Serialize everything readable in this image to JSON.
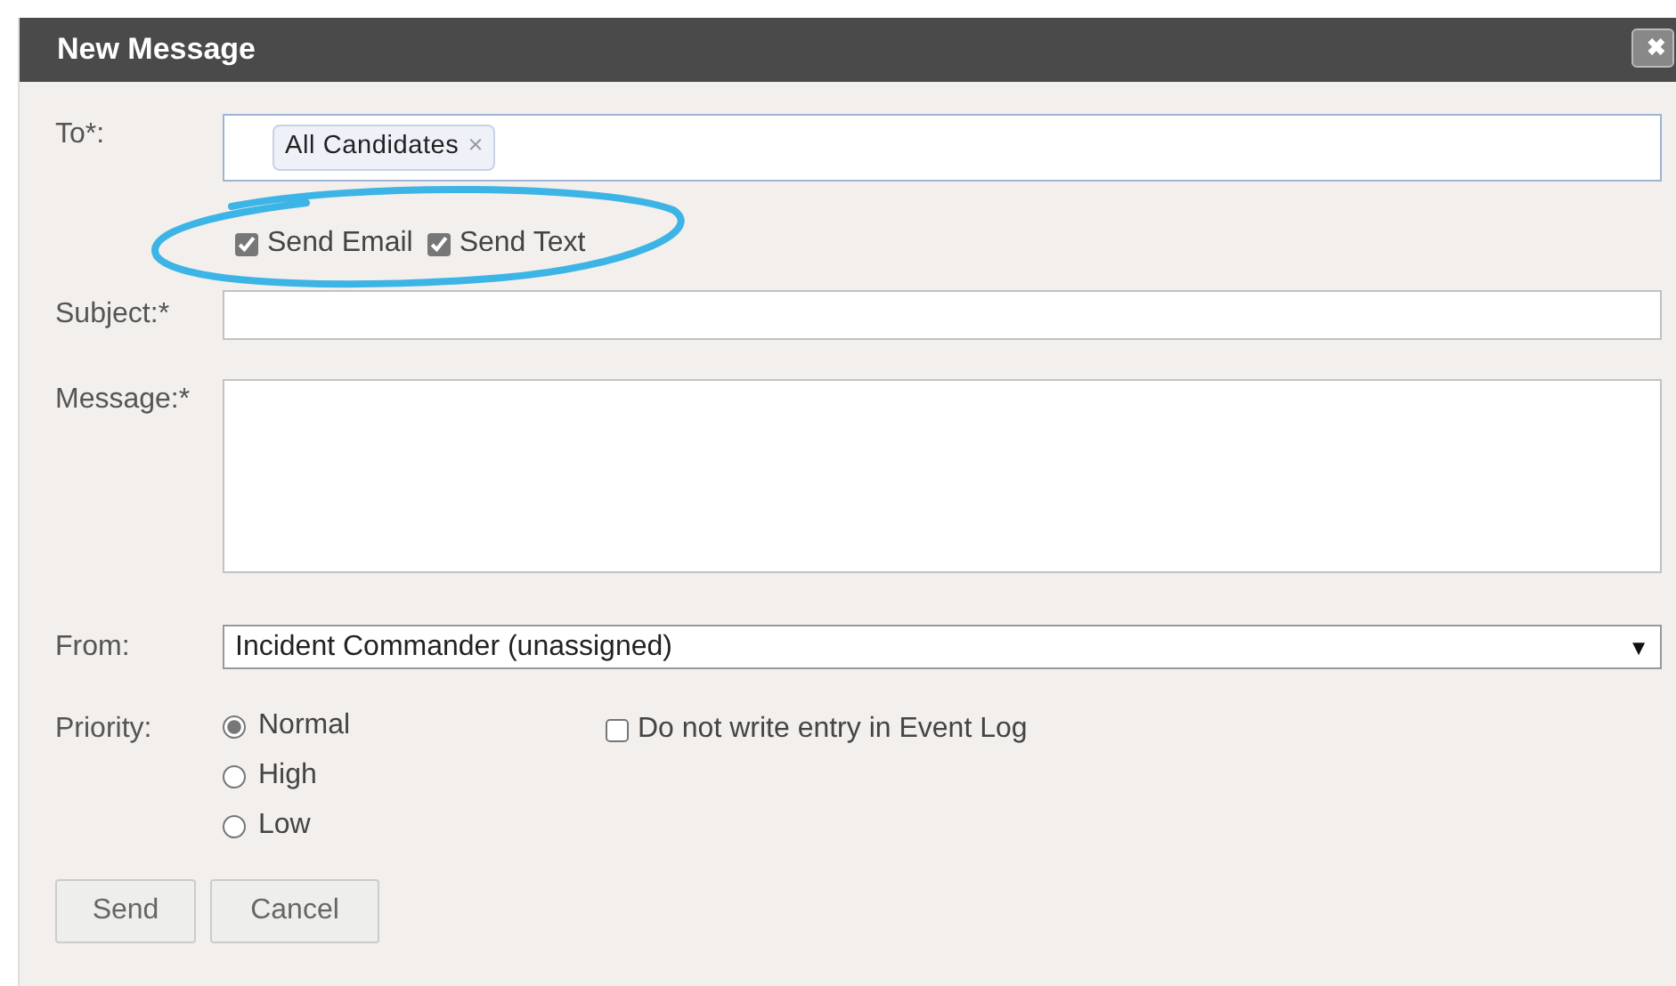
{
  "window": {
    "title": "New Message",
    "close_icon": "✖"
  },
  "to": {
    "label": "To*:",
    "tokens": [
      {
        "text": "All Candidates",
        "remove": "×"
      }
    ]
  },
  "send_options": [
    {
      "label": "Send Email",
      "checked": true
    },
    {
      "label": "Send Text",
      "checked": true
    }
  ],
  "subject": {
    "label": "Subject:*"
  },
  "message": {
    "label": "Message:*"
  },
  "from": {
    "label": "From:",
    "value": "Incident Commander (unassigned)",
    "caret": "▼"
  },
  "priority": {
    "label": "Priority:",
    "options": [
      {
        "label": "Normal",
        "selected": true
      },
      {
        "label": "High",
        "selected": false
      },
      {
        "label": "Low",
        "selected": false
      }
    ]
  },
  "no_event_log": {
    "label": "Do not write entry in Event Log",
    "checked": false
  },
  "buttons": [
    "Send",
    "Cancel"
  ]
}
